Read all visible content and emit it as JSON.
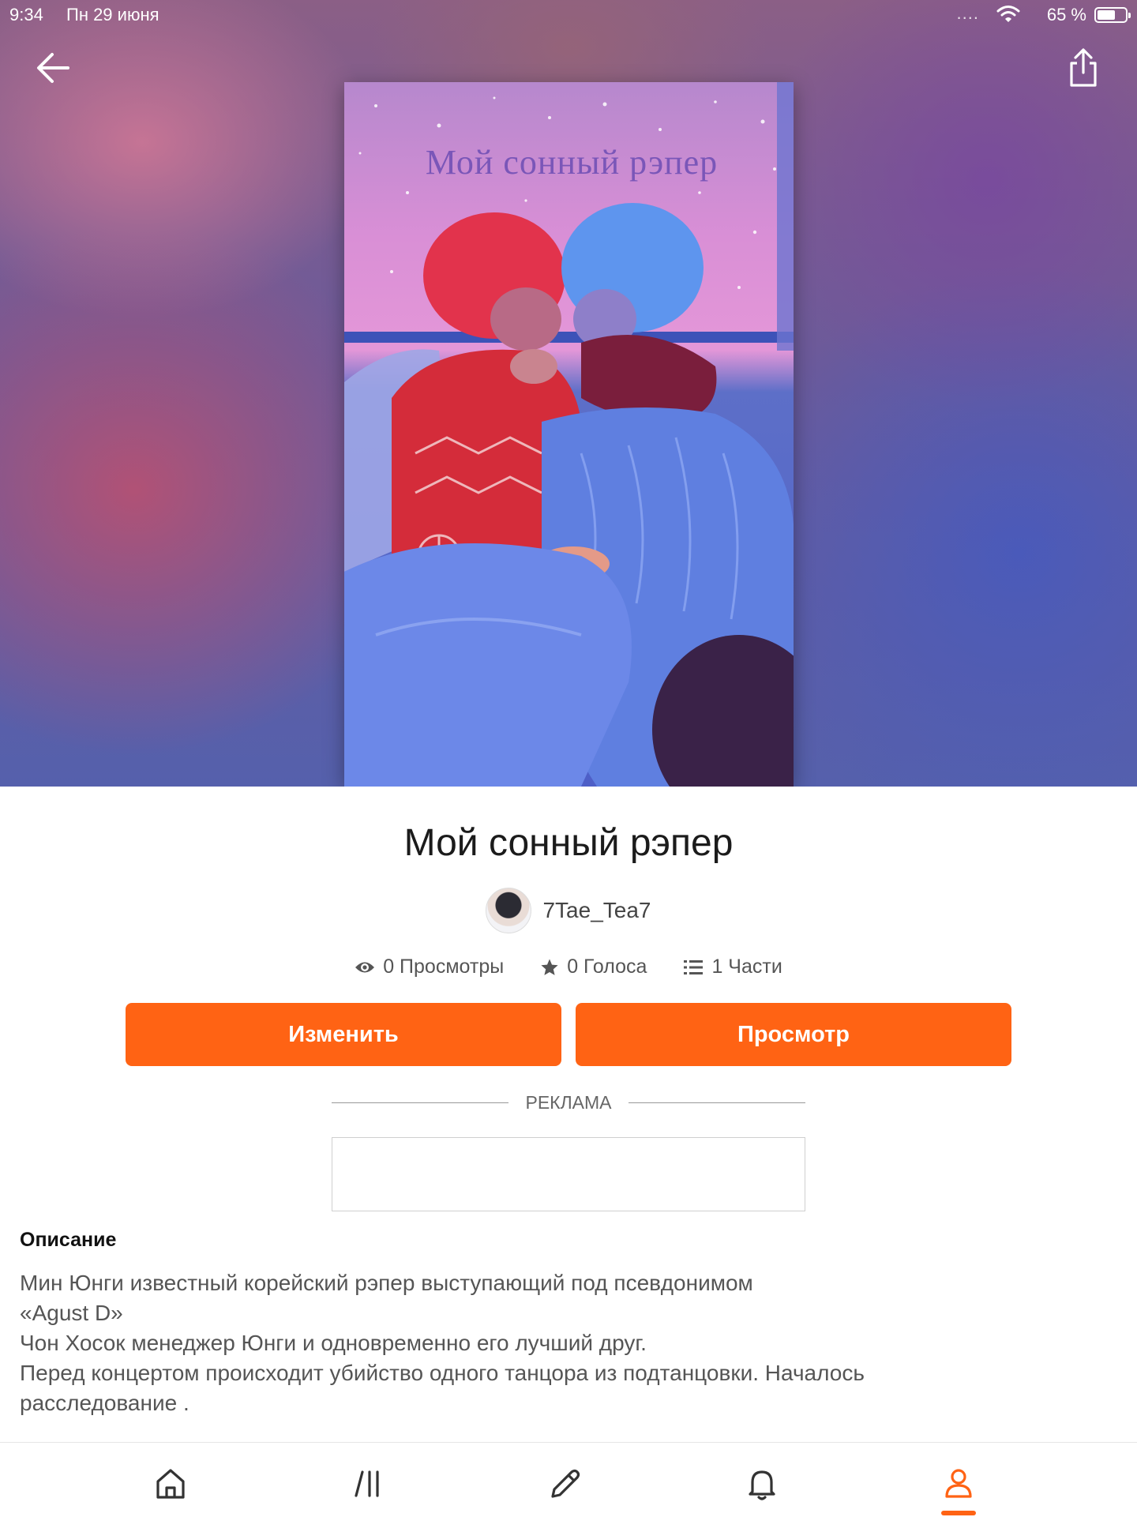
{
  "status_bar": {
    "time": "9:34",
    "date": "Пн 29 июня",
    "signal": "....",
    "battery_percent": "65 %",
    "battery_level": 0.65
  },
  "header": {
    "back_icon": "arrow-left-icon",
    "share_icon": "share-icon"
  },
  "cover": {
    "title": "Мой сонный рэпер"
  },
  "story": {
    "title": "Мой сонный рэпер",
    "author": "7Tae_Tea7",
    "stats": {
      "views": "0 Просмотры",
      "votes": "0 Голоса",
      "parts": "1 Части"
    }
  },
  "actions": {
    "edit_label": "Изменить",
    "view_label": "Просмотр"
  },
  "ad": {
    "label": "РЕКЛАМА"
  },
  "description": {
    "heading": "Описание",
    "lines": [
      "Мин Юнги известный корейский рэпер выступающий под псевдонимом",
      "«Agust D»",
      "Чон Хосок менеджер Юнги и одновременно его лучший друг.",
      "Перед концертом происходит убийство одного танцора из подтанцовки. Началось",
      "расследование ."
    ]
  },
  "tabbar": {
    "items": [
      "home-icon",
      "library-icon",
      "write-icon",
      "notifications-icon",
      "profile-icon"
    ],
    "active": "profile-icon"
  },
  "colors": {
    "accent": "#ff6314"
  }
}
